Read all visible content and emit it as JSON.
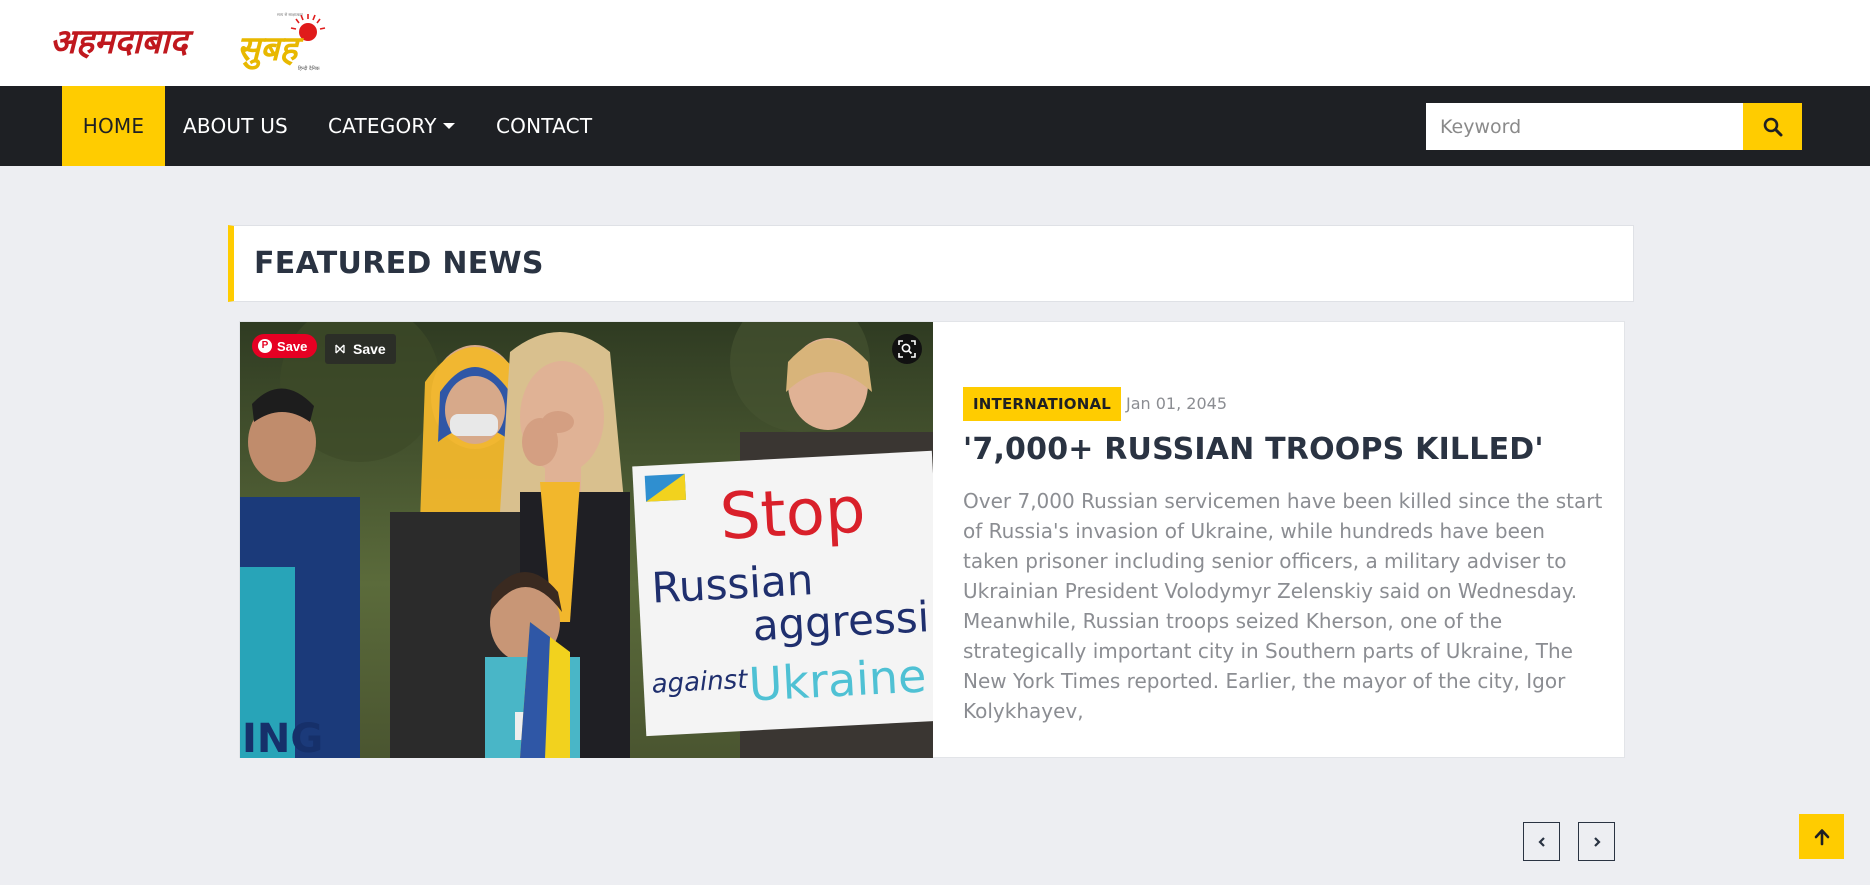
{
  "brand": {
    "logo_text_red": "अहमदाबाद",
    "logo_text_yellow": "सुबह",
    "logo_caption": "हिन्दी दैनिक",
    "logo_tagline": "सत्य से साक्षात्कार",
    "colors": {
      "red": "#c0181e",
      "yellow": "#e8b800",
      "accent": "#ffcc00",
      "dark": "#1e2024"
    }
  },
  "nav": {
    "items": [
      {
        "label": "HOME",
        "active": true
      },
      {
        "label": "ABOUT US",
        "active": false
      },
      {
        "label": "CATEGORY",
        "active": false,
        "dropdown": true
      },
      {
        "label": "CONTACT",
        "active": false
      }
    ]
  },
  "search": {
    "placeholder": "Keyword",
    "value": "",
    "button_icon": "search-icon"
  },
  "featured": {
    "title": "FEATURED NEWS",
    "article": {
      "category": "INTERNATIONAL",
      "date": "Jan 01, 2045",
      "headline": "'7,000+ RUSSIAN TROOPS KILLED'",
      "summary": "Over 7,000 Russian servicemen have been killed since the start of Russia's invasion of Ukraine, while hundreds have been taken prisoner including senior officers, a military adviser to Ukrainian President Volodymyr Zelenskiy said on Wednesday. Meanwhile, Russian troops seized Kherson, one of the strategically important city in Southern parts of Ukraine, The New York Times reported. Earlier, the mayor of the city, Igor Kolykhayev,",
      "image": {
        "sign_line1": "Stop",
        "sign_line2": "Russian",
        "sign_line3": "aggressi",
        "sign_line4": "against",
        "sign_line5": "Ukraine",
        "side_text": "ING"
      },
      "overlay": {
        "pinterest_save": "Save",
        "save": "Save",
        "lens_icon": "visual-search-icon"
      }
    },
    "controls": {
      "prev_icon": "chevron-left-icon",
      "next_icon": "chevron-right-icon"
    }
  },
  "back_to_top_icon": "arrow-up-icon"
}
